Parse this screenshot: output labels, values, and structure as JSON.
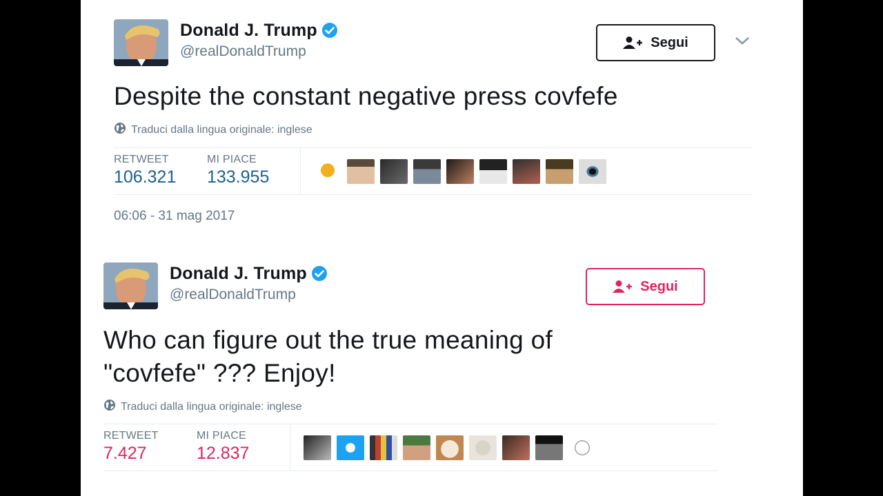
{
  "tweets": [
    {
      "author": {
        "name": "Donald J. Trump",
        "handle": "@realDonaldTrump",
        "verified": true
      },
      "follow_label": "Segui",
      "follow_color": "#14171a",
      "text": "Despite the constant negative press covfefe",
      "translate_label": "Traduci dalla lingua originale: inglese",
      "retweet_label": "RETWEET",
      "retweet_count": "106.321",
      "like_label": "MI PIACE",
      "like_count": "133.955",
      "count_color": "#1c5f8f",
      "timestamp": "06:06 - 31 mag 2017",
      "liker_avatar_count": 9
    },
    {
      "author": {
        "name": "Donald J. Trump",
        "handle": "@realDonaldTrump",
        "verified": true
      },
      "follow_label": "Segui",
      "follow_color": "#e0245e",
      "text_line1": "Who can figure out the true meaning of",
      "text_line2": "\"covfefe\" ???  Enjoy!",
      "translate_label": "Traduci dalla lingua originale: inglese",
      "retweet_label": "RETWEET",
      "retweet_count": "7.427",
      "like_label": "MI PIACE",
      "like_count": "12.837",
      "count_color": "#e0245e",
      "liker_avatar_count": 10
    }
  ],
  "icons": {
    "verified": "verified-badge-icon",
    "follow": "add-user-icon",
    "globe": "globe-icon",
    "menu": "chevron-down-icon"
  },
  "colors": {
    "verified_blue": "#1da1f2",
    "text_primary": "#14171a",
    "text_secondary": "#657786"
  }
}
